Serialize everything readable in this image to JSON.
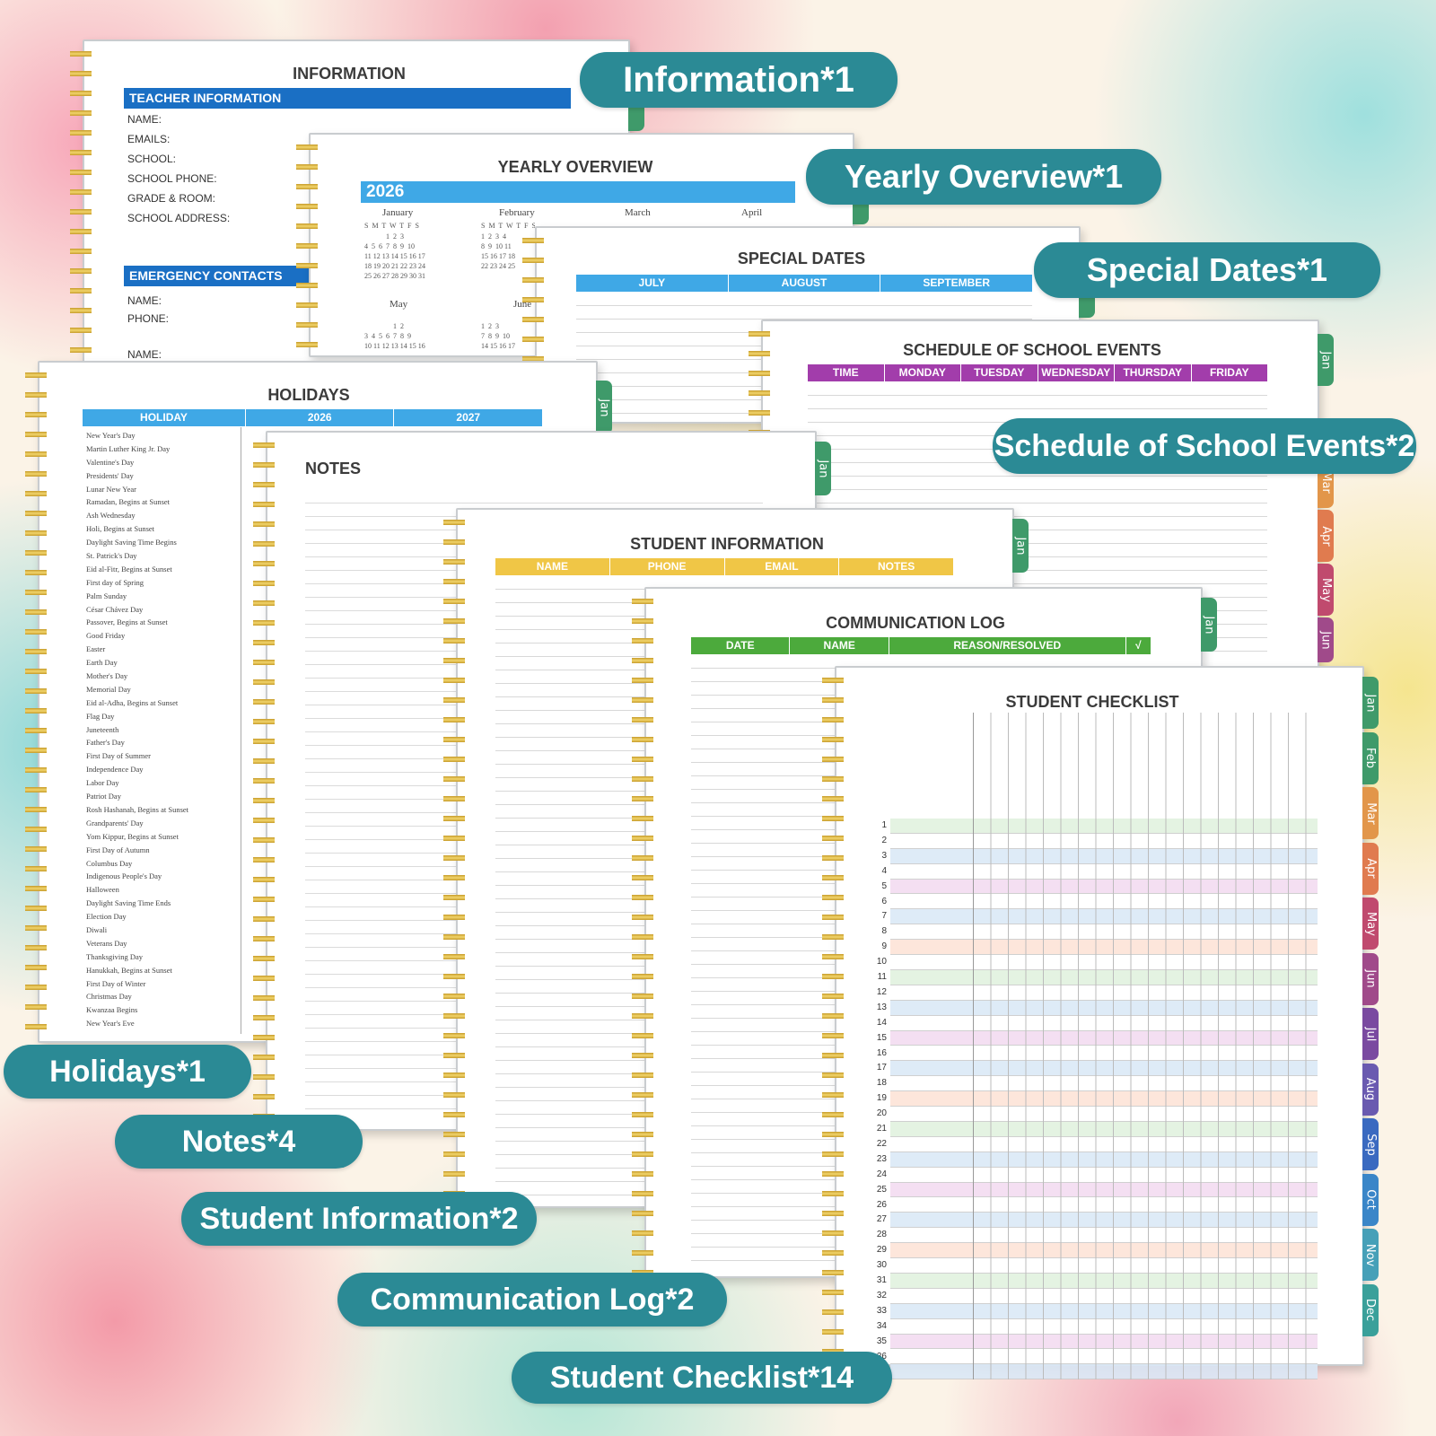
{
  "labels": {
    "information": "Information*1",
    "yearly": "Yearly Overview*1",
    "special": "Special Dates*1",
    "schedule": "Schedule of School Events*2",
    "holidays": "Holidays*1",
    "notes": "Notes*4",
    "student_info": "Student Information*2",
    "comm_log": "Communication Log*2",
    "checklist": "Student Checklist*14"
  },
  "information": {
    "title": "INFORMATION",
    "teacher_header": "TEACHER INFORMATION",
    "fields": [
      "NAME:",
      "EMAILS:",
      "SCHOOL:",
      "SCHOOL PHONE:",
      "GRADE & ROOM:",
      "SCHOOL ADDRESS:"
    ],
    "emergency_header": "EMERGENCY CONTACTS",
    "emergency_fields": [
      "NAME:",
      "PHONE:",
      "NAME:"
    ]
  },
  "yearly": {
    "title": "YEARLY OVERVIEW",
    "year": "2026",
    "months_top": [
      "January",
      "February",
      "March",
      "April"
    ],
    "months_bottom": [
      "May",
      "June"
    ],
    "weekdays": "S  M  T  W  T  F  S",
    "jan_rows": [
      "            1  2  3",
      "4  5  6  7  8  9  10",
      "11 12 13 14 15 16 17",
      "18 19 20 21 22 23 24",
      "25 26 27 28 29 30 31"
    ],
    "feb_rows": [
      "1  2  3  4",
      "8  9  10 11",
      "15 16 17 18",
      "22 23 24 25"
    ],
    "may_rows": [
      "                1  2",
      "3  4  5  6  7  8  9",
      "10 11 12 13 14 15 16"
    ],
    "june_rows": [
      "1  2  3",
      "7  8  9  10",
      "14 15 16 17"
    ]
  },
  "special": {
    "title": "SPECIAL DATES",
    "columns": [
      "JULY",
      "AUGUST",
      "SEPTEMBER"
    ]
  },
  "schedule": {
    "title": "SCHEDULE OF SCHOOL EVENTS",
    "columns": [
      "TIME",
      "MONDAY",
      "TUESDAY",
      "WEDNESDAY",
      "THURSDAY",
      "FRIDAY"
    ],
    "tabs": [
      "Jan",
      "Mar",
      "Apr",
      "May",
      "Jun"
    ]
  },
  "holidays": {
    "title": "HOLIDAYS",
    "columns": [
      "HOLIDAY",
      "2026",
      "2027"
    ],
    "tab": "Jan",
    "items": [
      "New Year's Day",
      "Martin Luther King Jr. Day",
      "Valentine's Day",
      "Presidents' Day",
      "Lunar New Year",
      "Ramadan, Begins at Sunset",
      "Ash Wednesday",
      "Holi, Begins at Sunset",
      "Daylight Saving Time Begins",
      "St. Patrick's Day",
      "Eid al-Fitr, Begins at Sunset",
      "First day of Spring",
      "Palm Sunday",
      "César Chávez Day",
      "Passover, Begins at Sunset",
      "Good Friday",
      "Easter",
      "Earth Day",
      "Mother's Day",
      "Memorial Day",
      "Eid al-Adha, Begins at Sunset",
      "Flag Day",
      "Juneteenth",
      "Father's Day",
      "First Day of Summer",
      "Independence Day",
      "Labor Day",
      "Patriot Day",
      "Rosh Hashanah, Begins at Sunset",
      "Grandparents' Day",
      "Yom Kippur, Begins at Sunset",
      "First Day of Autumn",
      "Columbus Day",
      "Indigenous People's Day",
      "Halloween",
      "Daylight Saving Time Ends",
      "Election Day",
      "Diwali",
      "Veterans Day",
      "Thanksgiving Day",
      "Hanukkah, Begins at Sunset",
      "First Day of Winter",
      "Christmas Day",
      "Kwanzaa Begins",
      "New Year's Eve"
    ]
  },
  "notes": {
    "title": "NOTES",
    "tab": "Jan"
  },
  "student_info": {
    "title": "STUDENT INFORMATION",
    "columns": [
      "NAME",
      "PHONE",
      "EMAIL",
      "NOTES"
    ],
    "tab": "Jan"
  },
  "comm_log": {
    "title": "COMMUNICATION LOG",
    "columns": [
      "DATE",
      "NAME",
      "REASON/RESOLVED",
      "√"
    ],
    "tab": "Jan"
  },
  "checklist": {
    "title": "STUDENT CHECKLIST",
    "rows": 37,
    "tabs": [
      "Jan",
      "Feb",
      "Mar",
      "Apr",
      "May",
      "Jun",
      "Jul",
      "Aug",
      "Sep",
      "Oct",
      "Nov",
      "Dec"
    ],
    "tab_colors": [
      "#3f9a6a",
      "#3f9a6a",
      "#e2964a",
      "#e07b4f",
      "#c04a6e",
      "#a04a8a",
      "#7a4aa0",
      "#6a5ab0",
      "#3a6ac0",
      "#3a86c8",
      "#46a0b8",
      "#3aa09a"
    ],
    "row_colors": [
      "#e2f2df",
      "#ffffff",
      "#dbe9f7",
      "#ffffff",
      "#f3dcf1",
      "#ffffff",
      "#dbe9f7",
      "#ffffff",
      "#fde4d8",
      "#ffffff"
    ]
  }
}
